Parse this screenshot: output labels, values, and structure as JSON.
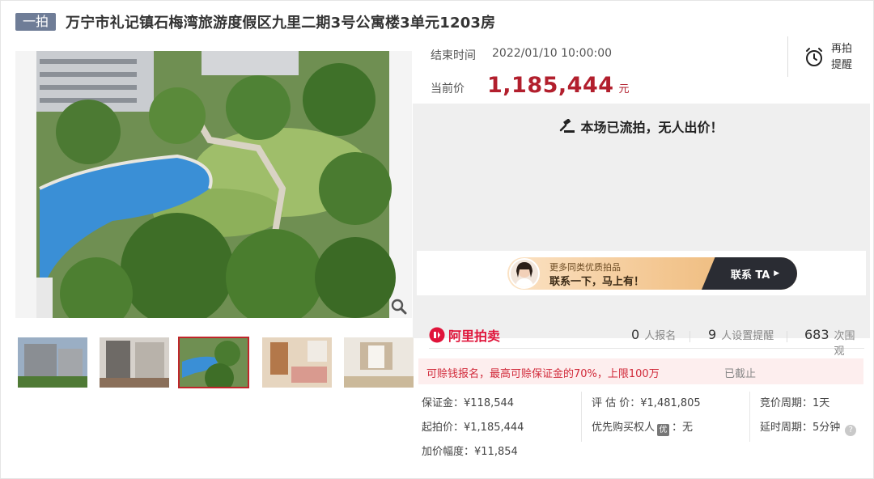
{
  "header": {
    "badge": "一拍",
    "title": "万宁市礼记镇石梅湾旅游度假区九里二期3号公寓楼3单元1203房"
  },
  "gallery": {
    "thumbnail_count": 5,
    "active_thumbnail": 3
  },
  "auction": {
    "end_label": "结束时间",
    "end_time": "2022/01/10 10:00:00",
    "price_label": "当前价",
    "price": "1,185,444",
    "price_unit": "元",
    "remind_line1": "再拍",
    "remind_line2": "提醒",
    "status": "本场已流拍，无人出价！"
  },
  "ad": {
    "line1": "更多同类优质拍品",
    "line2": "联系一下，马上有！",
    "cta": "联系 TA"
  },
  "stats": {
    "brand": "阿里拍卖",
    "signups_num": "0",
    "signups_unit": "人报名",
    "reminders_num": "9",
    "reminders_unit": "人设置提醒",
    "views_num": "683",
    "views_unit": "次围观"
  },
  "loan": {
    "text": "可赊钱报名，最高可赊保证金的70%，上限100万",
    "status": "已截止"
  },
  "info": {
    "deposit": "保证金：¥118,544",
    "start_price": "起拍价：¥1,185,444",
    "increment": "加价幅度：¥11,854",
    "appraisal": "评 估 价：¥1,481,805",
    "priority_label": "优先购买权人",
    "priority_badge": "优",
    "priority_value": "：无",
    "cycle": "竞价周期：1天",
    "extension": "延时周期：5分钟",
    "help": "?"
  },
  "colors": {
    "price_red": "#b21f2d",
    "brand_red": "#e0143a",
    "badge_blue": "#6f7d97",
    "active_thumb": "#c0262b"
  }
}
